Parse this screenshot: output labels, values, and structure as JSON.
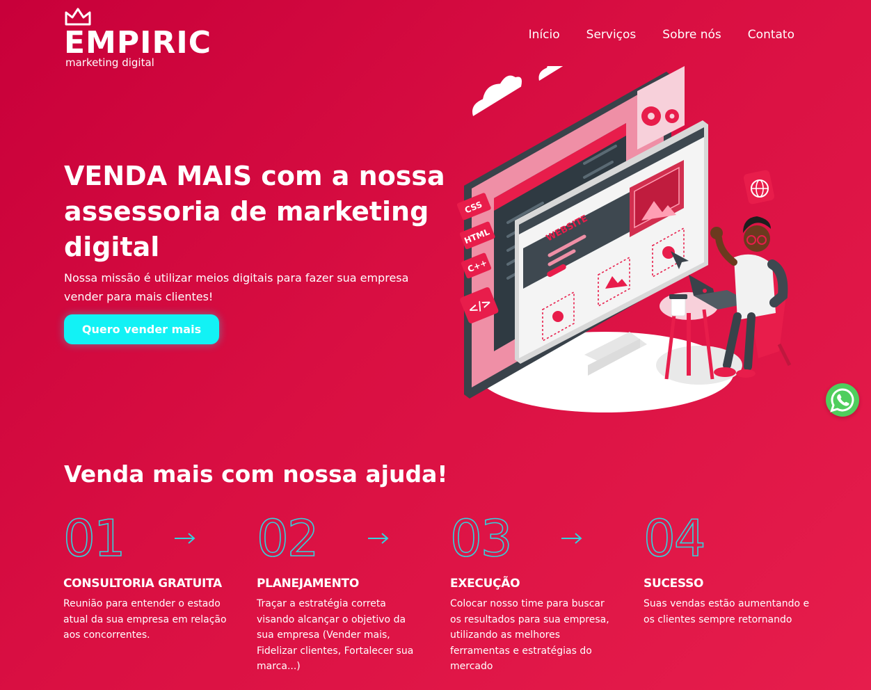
{
  "brand": {
    "name": "EMPIRIC",
    "tagline": "marketing digital"
  },
  "nav": {
    "items": [
      {
        "label": "Início"
      },
      {
        "label": "Serviços"
      },
      {
        "label": "Sobre nós"
      },
      {
        "label": "Contato"
      }
    ]
  },
  "hero": {
    "title": "VENDA MAIS com a nossa assessoria de marketing digital",
    "subtitle": "Nossa missão é utilizar meios digitais para fazer sua empresa vender para mais clientes!",
    "cta_label": "Quero vender mais"
  },
  "illustration": {
    "labels": {
      "css": "CSS",
      "html": "HTML",
      "cpp": "C++",
      "code": "</>",
      "website": "WEBSITE"
    }
  },
  "steps": {
    "title": "Venda mais com nossa ajuda!",
    "items": [
      {
        "number": "01",
        "title": "CONSULTORIA GRATUITA",
        "description": "Reunião para entender o estado atual da sua empresa em relação aos concorrentes."
      },
      {
        "number": "02",
        "title": "PLANEJAMENTO",
        "description": "Traçar a estratégia correta visando alcançar o objetivo da sua empresa (Vender mais, Fidelizar clientes, Fortalecer sua marca...)"
      },
      {
        "number": "03",
        "title": "EXECUÇÃO",
        "description": "Colocar nosso time para buscar os resultados para sua empresa, utilizando as melhores ferramentas e estratégias do mercado"
      },
      {
        "number": "04",
        "title": "SUCESSO",
        "description": "Suas vendas estão aumentando e os clientes sempre retornando"
      }
    ]
  },
  "colors": {
    "background": "#d20a3e",
    "accent_cyan": "#12f2f5",
    "number_stroke": "#34d3dc",
    "whatsapp": "#4fce5d"
  },
  "icons": {
    "crown": "crown-icon",
    "whatsapp": "whatsapp-icon",
    "arrow": "arrow-right-icon"
  }
}
